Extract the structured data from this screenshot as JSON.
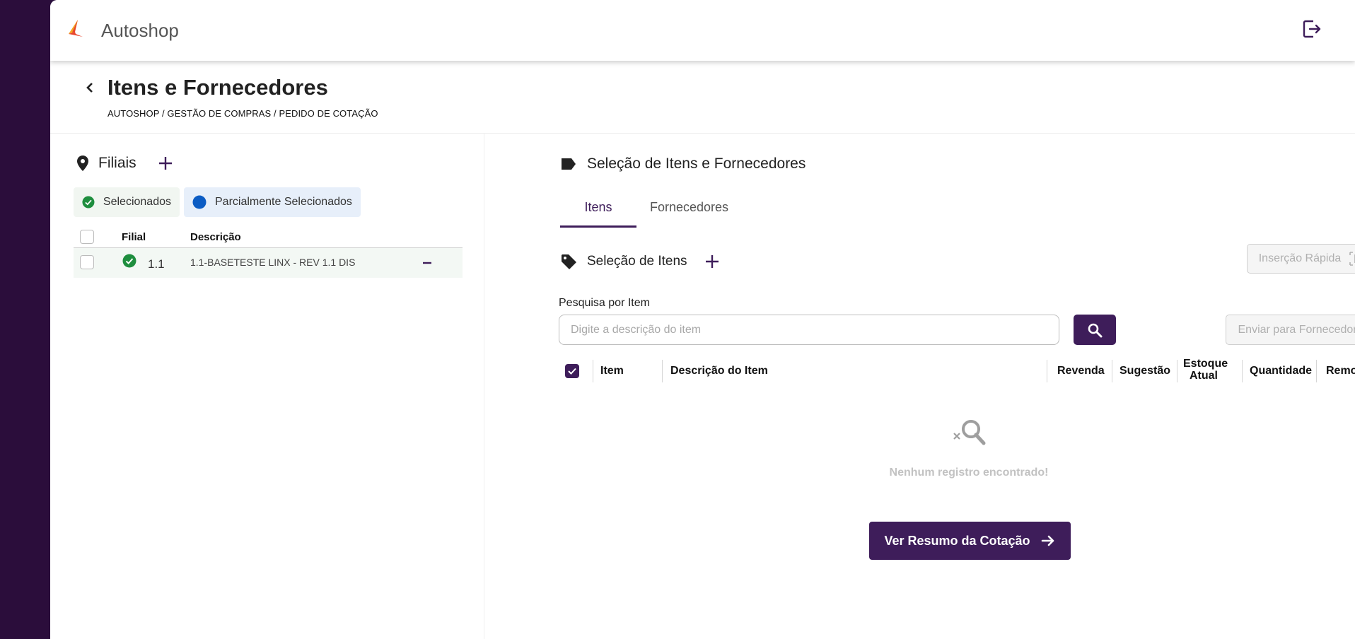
{
  "app": {
    "title": "Autoshop"
  },
  "page": {
    "title": "Itens e Fornecedores",
    "breadcrumb": "AUTOSHOP / GESTÃO DE COMPRAS / PEDIDO DE COTAÇÃO"
  },
  "filiais": {
    "title": "Filiais",
    "legend": {
      "selected": "Selecionados",
      "partial": "Parcialmente Selecionados"
    },
    "columns": {
      "filial": "Filial",
      "descricao": "Descrição"
    },
    "rows": [
      {
        "filial": "1.1",
        "descricao": "1.1-BASETESTE LINX - REV 1.1 DIS"
      }
    ]
  },
  "selection": {
    "title": "Seleção de Itens e Fornecedores",
    "tabs": [
      {
        "label": "Itens"
      },
      {
        "label": "Fornecedores"
      }
    ],
    "items_title": "Seleção de Itens",
    "quick_insert_label": "Inserção Rápida",
    "search_label": "Pesquisa por Item",
    "search_placeholder": "Digite a descrição do item",
    "send_label": "Enviar para Fornecedores",
    "columns": {
      "item": "Item",
      "descricao": "Descrição do Item",
      "revenda": "Revenda",
      "sugestao": "Sugestão",
      "estoque_1": "Estoque",
      "estoque_2": "Atual",
      "quantidade": "Quantidade",
      "remover": "Remover"
    },
    "empty_text": "Nenhum registro encontrado!",
    "summary_button": "Ver Resumo da Cotação"
  },
  "colors": {
    "primary": "#3e1d5a",
    "success": "#1e8e3e",
    "partial": "#0b5cc4"
  },
  "icons": [
    "logo-icon",
    "logout-icon",
    "back-icon",
    "location-pin-icon",
    "plus-icon",
    "check-circle-icon",
    "dot-circle-icon",
    "minus-icon",
    "label-icon",
    "tag-icon",
    "barcode-icon",
    "search-icon",
    "search-empty-icon",
    "arrow-right-icon"
  ]
}
